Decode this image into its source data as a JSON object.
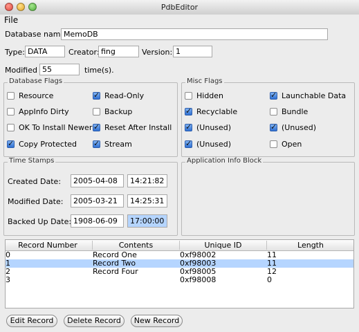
{
  "window": {
    "title": "PdbEditor"
  },
  "menu": [
    "File"
  ],
  "db": {
    "name_label": "Database name:",
    "name_value": "MemoDB",
    "type_label": "Type:",
    "type_value": "DATA",
    "creator_label": "Creator:",
    "creator_value": "fing",
    "version_label": "Version:",
    "version_value": "1",
    "modified_label": "Modified",
    "modified_value": "55",
    "modified_suffix": "time(s)."
  },
  "db_flags": {
    "title": "Database Flags",
    "items": [
      {
        "label": "Resource",
        "checked": false
      },
      {
        "label": "Read-Only",
        "checked": true
      },
      {
        "label": "AppInfo Dirty",
        "checked": false
      },
      {
        "label": "Backup",
        "checked": false
      },
      {
        "label": "OK To Install Newer",
        "checked": false
      },
      {
        "label": "Reset After Install",
        "checked": true
      },
      {
        "label": "Copy Protected",
        "checked": true
      },
      {
        "label": "Stream",
        "checked": true
      }
    ]
  },
  "misc_flags": {
    "title": "Misc Flags",
    "items": [
      {
        "label": "Hidden",
        "checked": false
      },
      {
        "label": "Launchable Data",
        "checked": true
      },
      {
        "label": "Recyclable",
        "checked": true
      },
      {
        "label": "Bundle",
        "checked": false
      },
      {
        "label": "(Unused)",
        "checked": true
      },
      {
        "label": "(Unused)",
        "checked": true
      },
      {
        "label": "(Unused)",
        "checked": true
      },
      {
        "label": "Open",
        "checked": false
      }
    ]
  },
  "time_stamps": {
    "title": "Time Stamps",
    "rows": [
      {
        "label": "Created Date:",
        "date": "2005-04-08",
        "time": "14:21:82"
      },
      {
        "label": "Modified Date:",
        "date": "2005-03-21",
        "time": "14:25:31"
      },
      {
        "label": "Backed Up Date:",
        "date": "1908-06-09",
        "time": "17:00:00"
      }
    ]
  },
  "app_info": {
    "title": "Application Info Block"
  },
  "records": {
    "columns": [
      "Record Number",
      "Contents",
      "Unique ID",
      "Length"
    ],
    "rows": [
      [
        "0",
        "Record One",
        "0xf98002",
        "11"
      ],
      [
        "1",
        "Record Two",
        "0xf98003",
        "11"
      ],
      [
        "2",
        "Record Four",
        "0xf98005",
        "12"
      ],
      [
        "3",
        "",
        "0xf98008",
        "0"
      ]
    ],
    "selected_index": 1
  },
  "buttons": {
    "edit": "Edit Record",
    "delete": "Delete Record",
    "new": "New Record"
  }
}
